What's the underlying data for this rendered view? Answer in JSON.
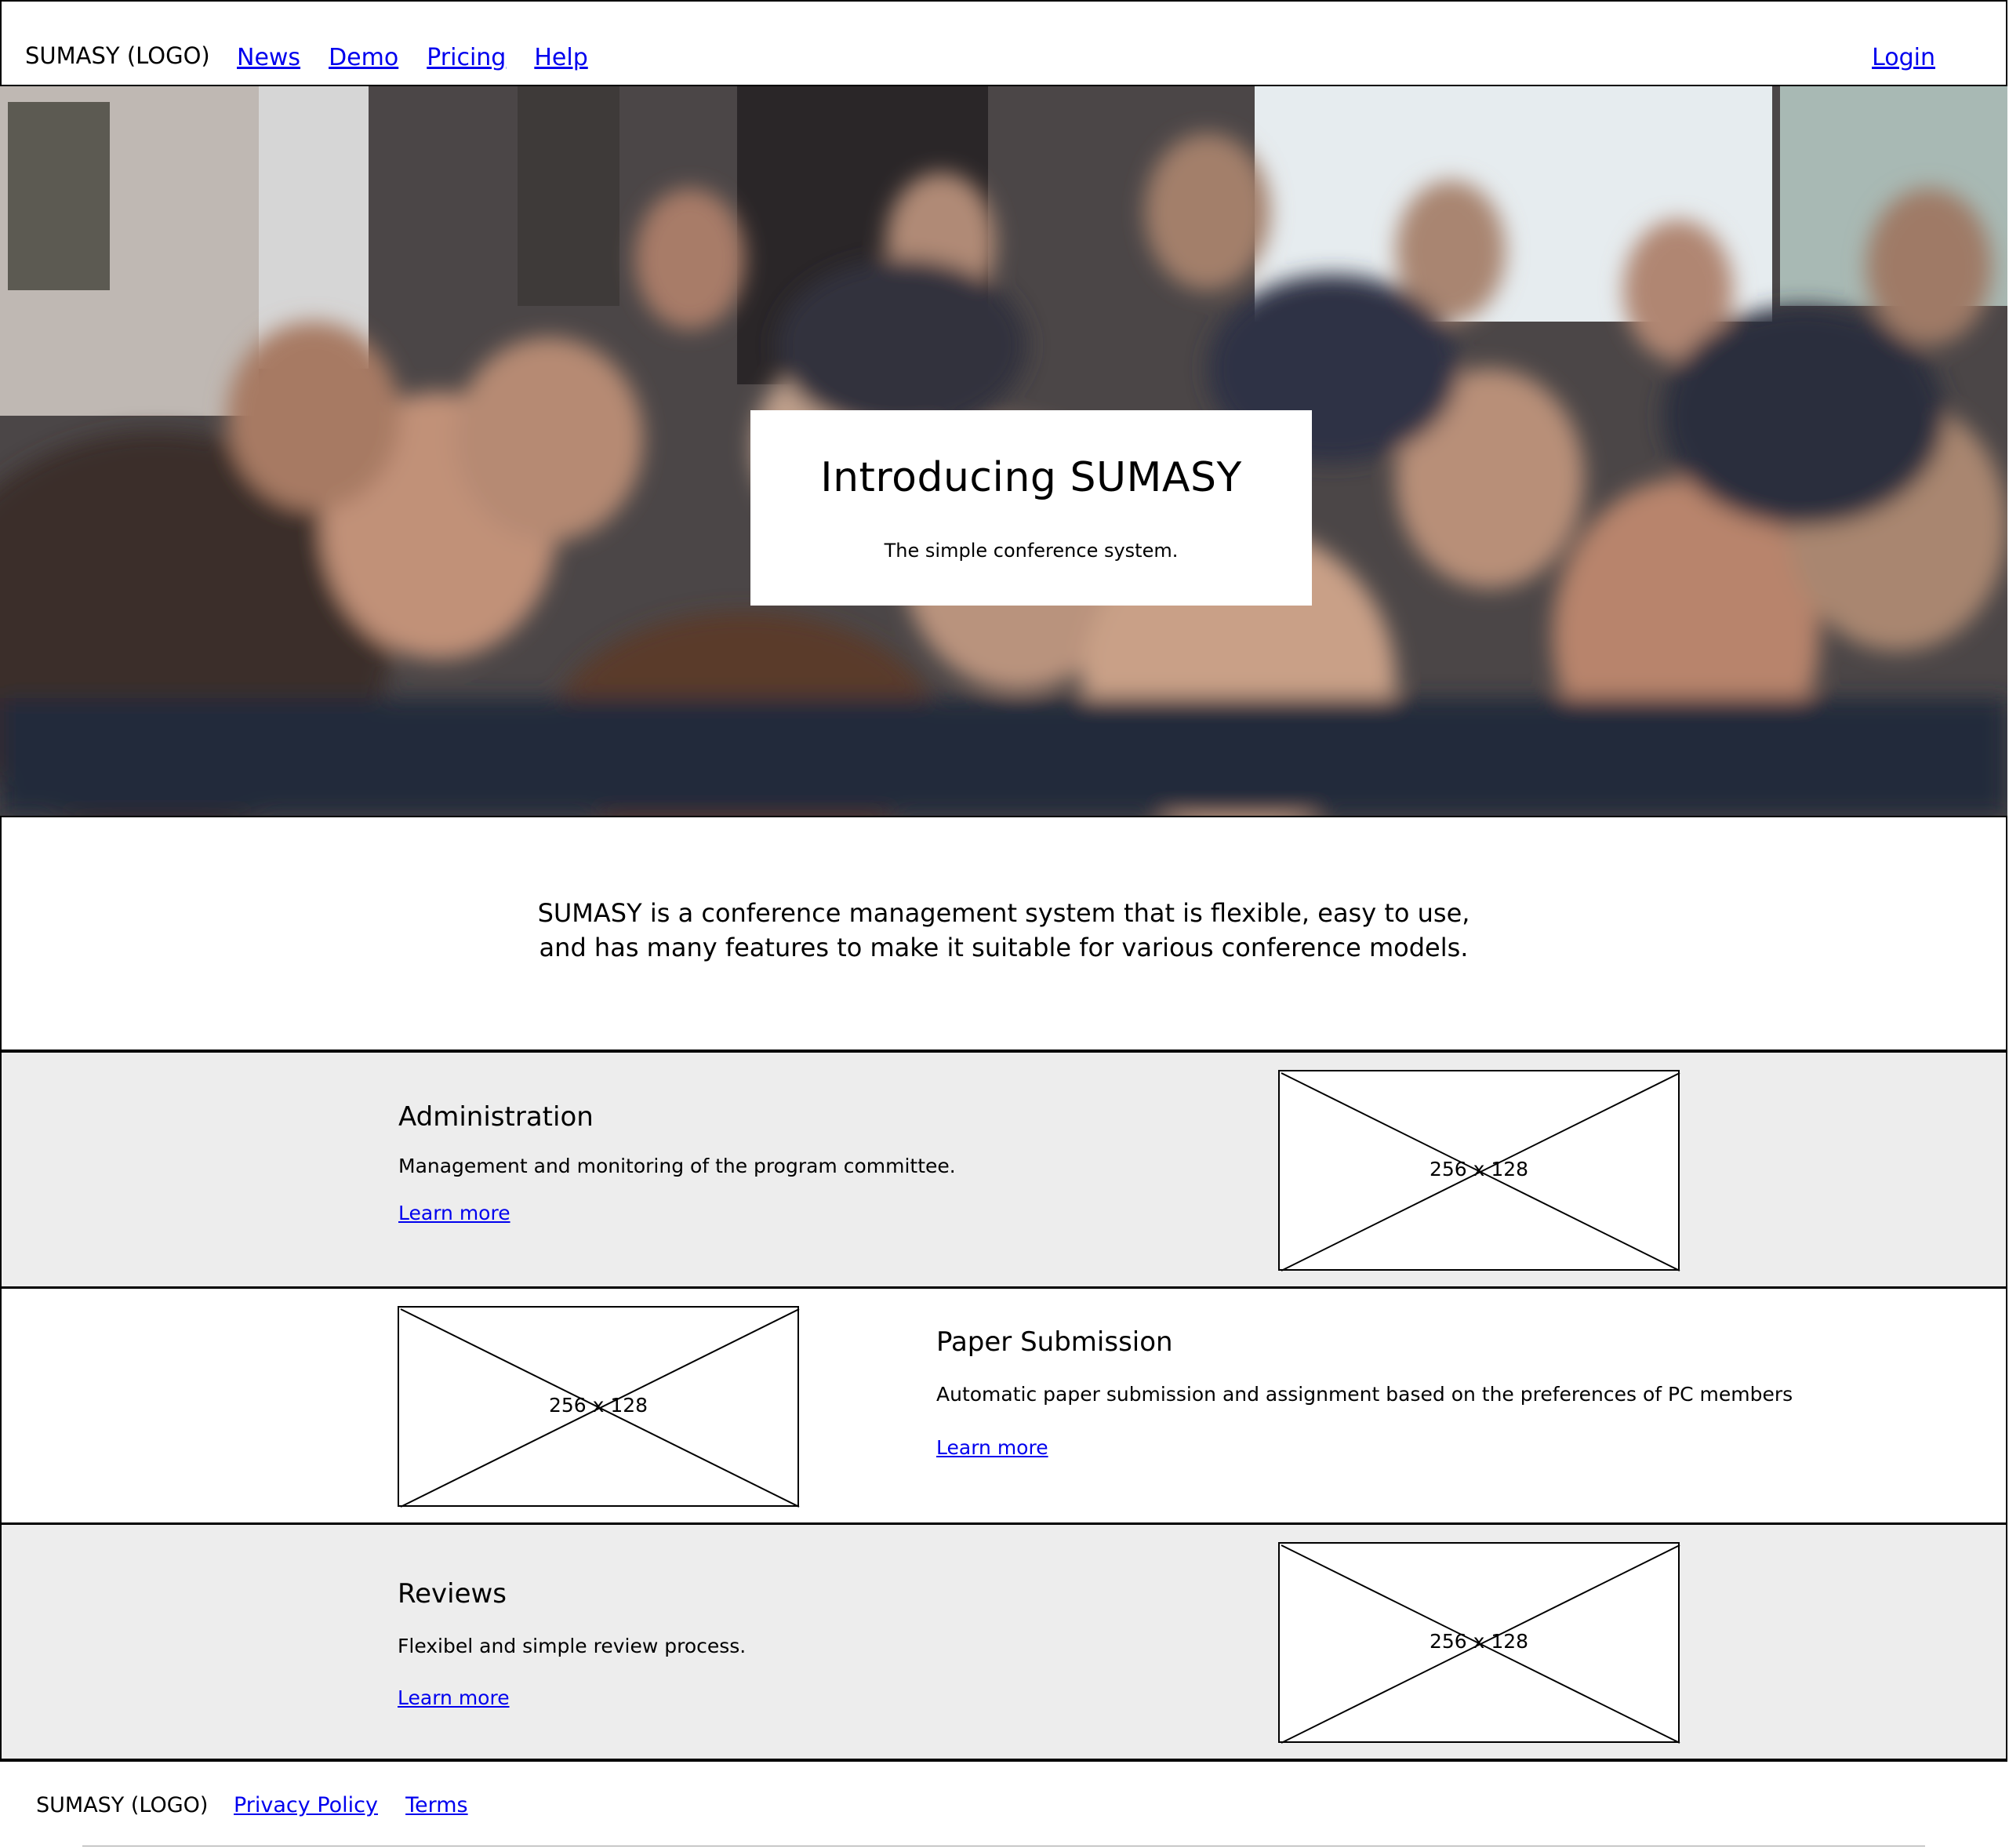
{
  "nav": {
    "logo": "SUMASY (LOGO)",
    "links": [
      "News",
      "Demo",
      "Pricing",
      "Help"
    ],
    "login": "Login"
  },
  "hero": {
    "title": "Introducing SUMASY",
    "subtitle": "The simple conference system."
  },
  "intro": {
    "line1": "SUMASY is a conference management system that is flexible, easy to use,",
    "line2": "and has many features to make it suitable for various conference models."
  },
  "features": [
    {
      "title": "Administration",
      "description": "Management and monitoring of the program committee.",
      "link": "Learn more",
      "image_label": "256 x 128"
    },
    {
      "title": "Paper Submission",
      "description": "Automatic paper submission and assignment based on the preferences of PC members",
      "link": "Learn more",
      "image_label": "256 x 128"
    },
    {
      "title": "Reviews",
      "description": "Flexibel and simple review process.",
      "link": "Learn more",
      "image_label": "256 x 128"
    }
  ],
  "footer": {
    "logo": "SUMASY (LOGO)",
    "links": [
      "Privacy Policy",
      "Terms"
    ]
  },
  "colors": {
    "link": "#0000ee",
    "feature_grey": "#ededed",
    "border": "#000000"
  },
  "icons": {
    "image_placeholder": "crossed-box-placeholder-icon"
  }
}
